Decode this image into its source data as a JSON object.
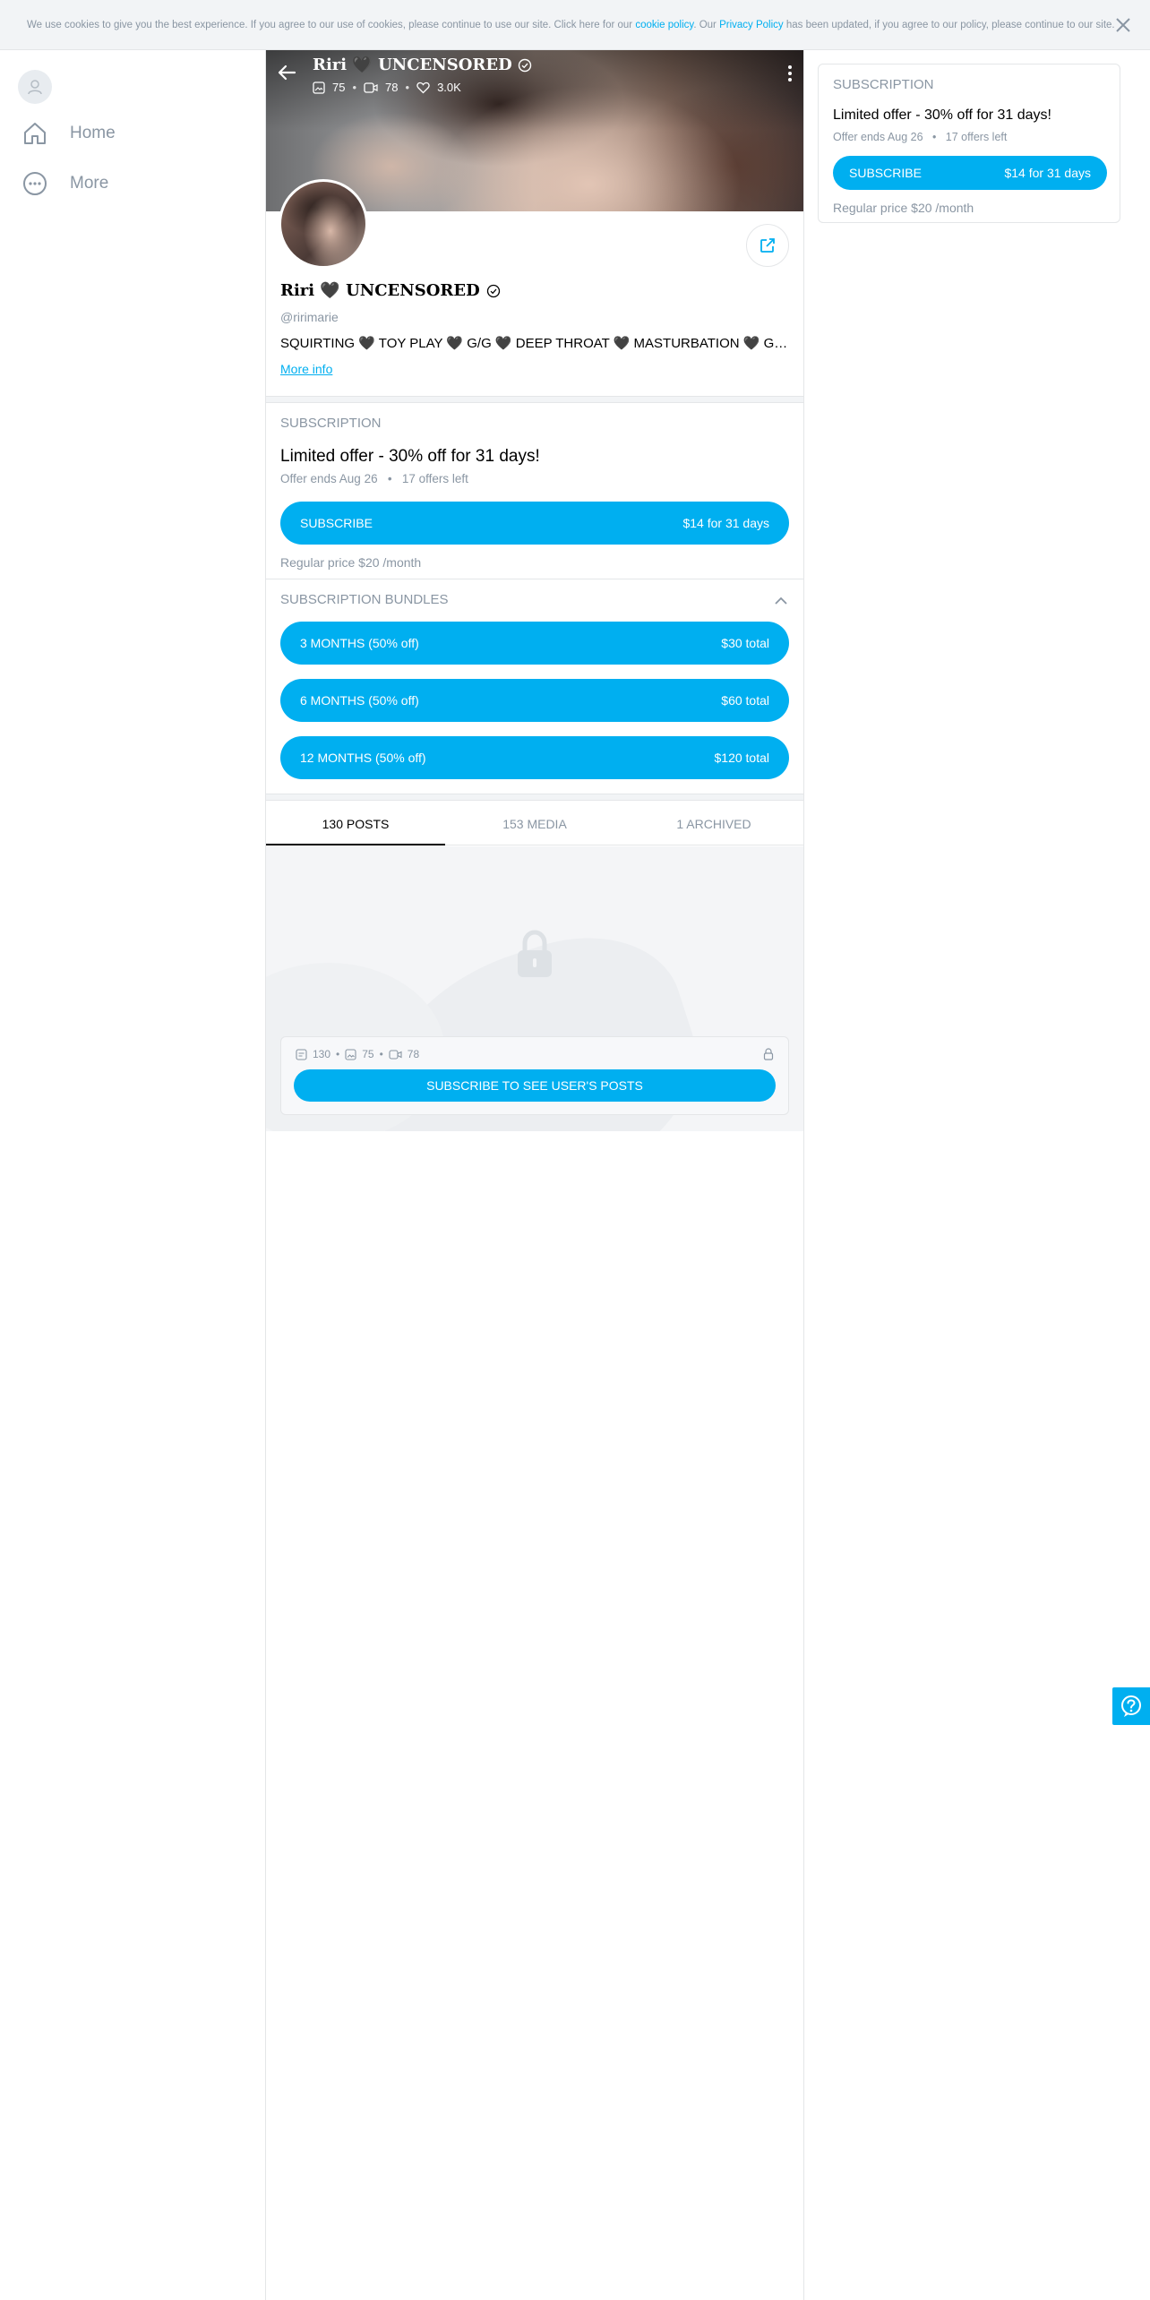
{
  "cookie": {
    "text_before": "We use cookies to give you the best experience. If you agree to our use of cookies, please continue to use our site. Click here for our ",
    "cookie_policy_link": "cookie policy",
    "text_middle": ". Our ",
    "privacy_policy_link": "Privacy Policy",
    "text_after": " has been updated, if you agree to our policy, please continue to our site."
  },
  "sidebar": {
    "items": [
      {
        "label": "Home",
        "icon": "home-icon"
      },
      {
        "label": "More",
        "icon": "more-circle-icon"
      }
    ]
  },
  "profile": {
    "cover_title": "Riri 🖤 UNCENSORED",
    "photos_count": "75",
    "videos_count": "78",
    "likes_count": "3.0K",
    "name": "Riri 🖤 UNCENSORED",
    "handle": "@ririmarie",
    "bio": "SQUIRTING 🖤 TOY PLAY 🖤 G/G 🖤 DEEP THROAT 🖤 MASTURBATION 🖤 G/B 🖤 BJS 🖤 CUSTOM VIDEOS",
    "more_info": "More info"
  },
  "subscription": {
    "label": "SUBSCRIPTION",
    "offer_title": "Limited offer - 30% off for 31 days!",
    "offer_ends": "Offer ends Aug 26",
    "offers_left": "17 offers left",
    "subscribe_label": "SUBSCRIBE",
    "subscribe_price": "$14 for 31 days",
    "regular_price": "Regular price $20 /month"
  },
  "bundles": {
    "label": "SUBSCRIPTION BUNDLES",
    "items": [
      {
        "label": "3 MONTHS (50% off)",
        "price": "$30 total"
      },
      {
        "label": "6 MONTHS (50% off)",
        "price": "$60 total"
      },
      {
        "label": "12 MONTHS (50% off)",
        "price": "$120 total"
      }
    ]
  },
  "tabs": [
    {
      "label": "130 POSTS",
      "active": true
    },
    {
      "label": "153 MEDIA",
      "active": false
    },
    {
      "label": "1 ARCHIVED",
      "active": false
    }
  ],
  "locked": {
    "posts_count": "130",
    "photos_count": "75",
    "videos_count": "78",
    "button_label": "SUBSCRIBE TO SEE USER'S POSTS"
  },
  "colors": {
    "accent": "#00aff0",
    "muted": "#8a96a3",
    "border": "#e4e6e8"
  }
}
